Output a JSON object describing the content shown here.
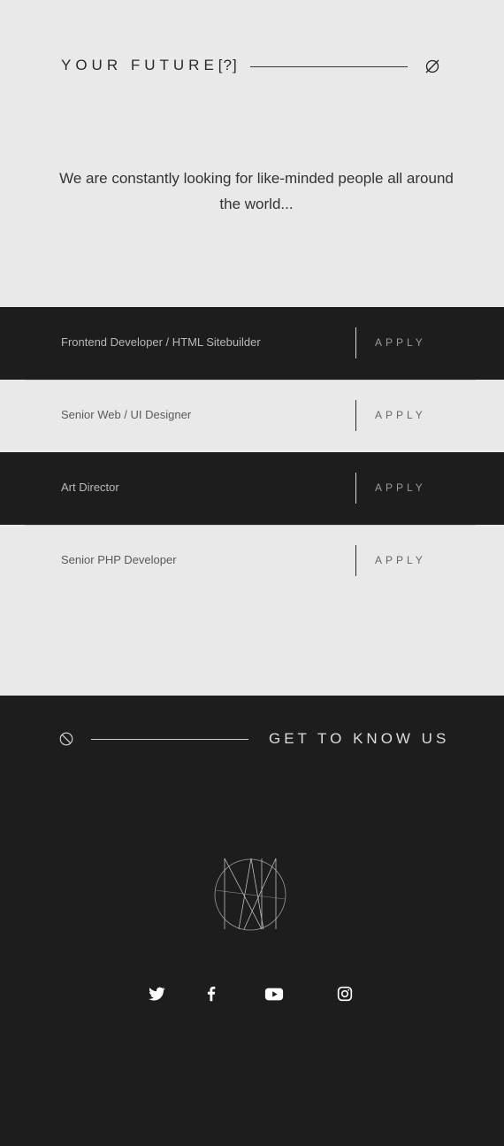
{
  "header": {
    "title": "YOUR FUTURE",
    "title_suffix": "[?]",
    "empty_icon": "empty-set-icon"
  },
  "intro": {
    "text": "We are constantly looking for like-minded people all around the world..."
  },
  "jobs": [
    {
      "title": "Frontend Developer / HTML Sitebuilder",
      "action": "APPLY"
    },
    {
      "title": "Senior Web / UI Designer",
      "action": "APPLY"
    },
    {
      "title": "Art Director",
      "action": "APPLY"
    },
    {
      "title": "Senior PHP Developer",
      "action": "APPLY"
    }
  ],
  "footer": {
    "title": "GET TO KNOW US",
    "ban_icon": "ban-icon",
    "logo": "monogram-logo",
    "social": [
      {
        "name": "twitter-icon"
      },
      {
        "name": "facebook-icon"
      },
      {
        "name": "youtube-icon"
      },
      {
        "name": "instagram-icon"
      }
    ]
  },
  "colors": {
    "light_bg": "#e9e9e9",
    "dark_bg": "#1d1d1d",
    "text_dark": "#2a2a2a",
    "text_light": "#dcdcdc"
  }
}
